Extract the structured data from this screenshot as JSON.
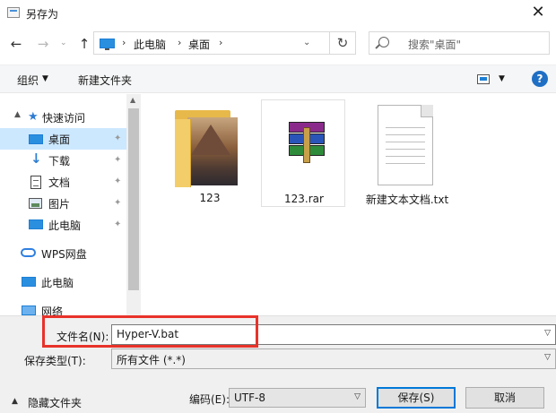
{
  "window": {
    "title": "另存为",
    "close_glyph": "✕"
  },
  "nav": {
    "back": "←",
    "forward": "→",
    "recent": "⌄",
    "up": "↑"
  },
  "address": {
    "crumbs": [
      "此电脑",
      "桌面"
    ],
    "separator": "›",
    "refresh": "↻"
  },
  "search": {
    "placeholder": "搜索\"桌面\""
  },
  "toolbar": {
    "organize": "组织",
    "new_folder": "新建文件夹",
    "help": "?"
  },
  "sidebar": {
    "items": [
      {
        "label": "快速访问",
        "icon": "star-icon",
        "expand": "^"
      },
      {
        "label": "桌面",
        "icon": "desktop-icon",
        "pinned": true,
        "selected": true
      },
      {
        "label": "下载",
        "icon": "download-icon",
        "pinned": true
      },
      {
        "label": "文档",
        "icon": "document-icon",
        "pinned": true
      },
      {
        "label": "图片",
        "icon": "picture-icon",
        "pinned": true
      },
      {
        "label": "此电脑",
        "icon": "computer-icon",
        "pinned": true
      },
      {
        "label": "WPS网盘",
        "icon": "cloud-icon"
      },
      {
        "label": "此电脑",
        "icon": "computer-icon"
      },
      {
        "label": "网络",
        "icon": "network-icon"
      }
    ],
    "pin_glyph": "📌"
  },
  "files": [
    {
      "name": "123",
      "type": "folder"
    },
    {
      "name": "123.rar",
      "type": "rar-archive"
    },
    {
      "name": "新建文本文档.txt",
      "type": "text-file"
    }
  ],
  "form": {
    "filename_label": "文件名(N):",
    "filename_value": "Hyper-V.bat",
    "filetype_label": "保存类型(T):",
    "filetype_value": "所有文件  (*.*)",
    "hide_folders": "隐藏文件夹",
    "encoding_label": "编码(E):",
    "encoding_value": "UTF-8",
    "save": "保存(S)",
    "cancel": "取消"
  },
  "colors": {
    "accent": "#0078d7",
    "highlight_frame": "#e8322a",
    "selection": "#cce8ff"
  }
}
